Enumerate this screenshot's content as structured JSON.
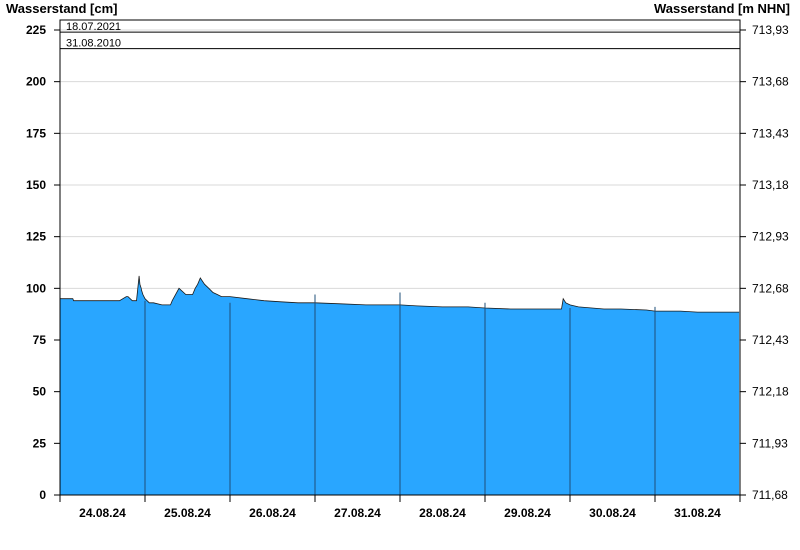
{
  "chart_data": {
    "type": "area",
    "ylabel_left": "Wasserstand [cm]",
    "ylabel_right": "Wasserstand [m NHN]",
    "ylim": [
      0,
      225
    ],
    "yticks_left": [
      0,
      25,
      50,
      75,
      100,
      125,
      150,
      175,
      200,
      225
    ],
    "yticks_right": [
      "711,68",
      "711,93",
      "712,18",
      "712,43",
      "712,68",
      "712,93",
      "713,18",
      "713,43",
      "713,68",
      "713,93"
    ],
    "x_start": "24.08.24",
    "x_days": 8,
    "xticks": [
      "24.08.24",
      "25.08.24",
      "26.08.24",
      "27.08.24",
      "28.08.24",
      "29.08.24",
      "30.08.24",
      "31.08.24"
    ],
    "grid": true,
    "reference_lines": [
      {
        "label": "18.07.2021",
        "value": 224
      },
      {
        "label": "31.08.2010",
        "value": 216
      }
    ],
    "colors": {
      "fill": "#29a6ff",
      "line": "#1a1a1a",
      "grid": "#d9d9d9"
    },
    "series": [
      {
        "x": [
          0.0,
          0.15,
          0.16,
          0.4,
          0.7,
          0.78,
          0.8,
          0.85,
          0.9,
          0.93,
          0.94,
          0.955,
          0.96,
          0.975,
          1.0,
          1.05,
          1.1,
          1.2,
          1.3,
          1.32,
          1.4,
          1.48,
          1.52,
          1.56,
          1.59,
          1.62,
          1.65,
          1.7,
          1.75,
          1.8,
          1.85,
          1.9,
          2.0,
          2.2,
          2.4,
          2.6,
          2.8,
          3.0,
          3.3,
          3.6,
          4.0,
          4.2,
          4.5,
          4.8,
          5.0,
          5.3,
          5.7,
          5.9,
          5.92,
          5.95,
          6.0,
          6.1,
          6.4,
          6.6,
          6.9,
          7.0,
          7.3,
          7.5,
          7.99
        ],
        "y": [
          95,
          95,
          94,
          94,
          94,
          96,
          96,
          94,
          94,
          106,
          102,
          100,
          99,
          97,
          95,
          93,
          93,
          92,
          92,
          94,
          100,
          97,
          97,
          97,
          100,
          102,
          105,
          102,
          100,
          98,
          97,
          96,
          96,
          95,
          94,
          93.5,
          93,
          93,
          92.5,
          92,
          92,
          91.5,
          91,
          91,
          90.5,
          90,
          90,
          90,
          95,
          93,
          92,
          91,
          90,
          90,
          89.5,
          89,
          89,
          88.5,
          88.5
        ]
      }
    ]
  }
}
